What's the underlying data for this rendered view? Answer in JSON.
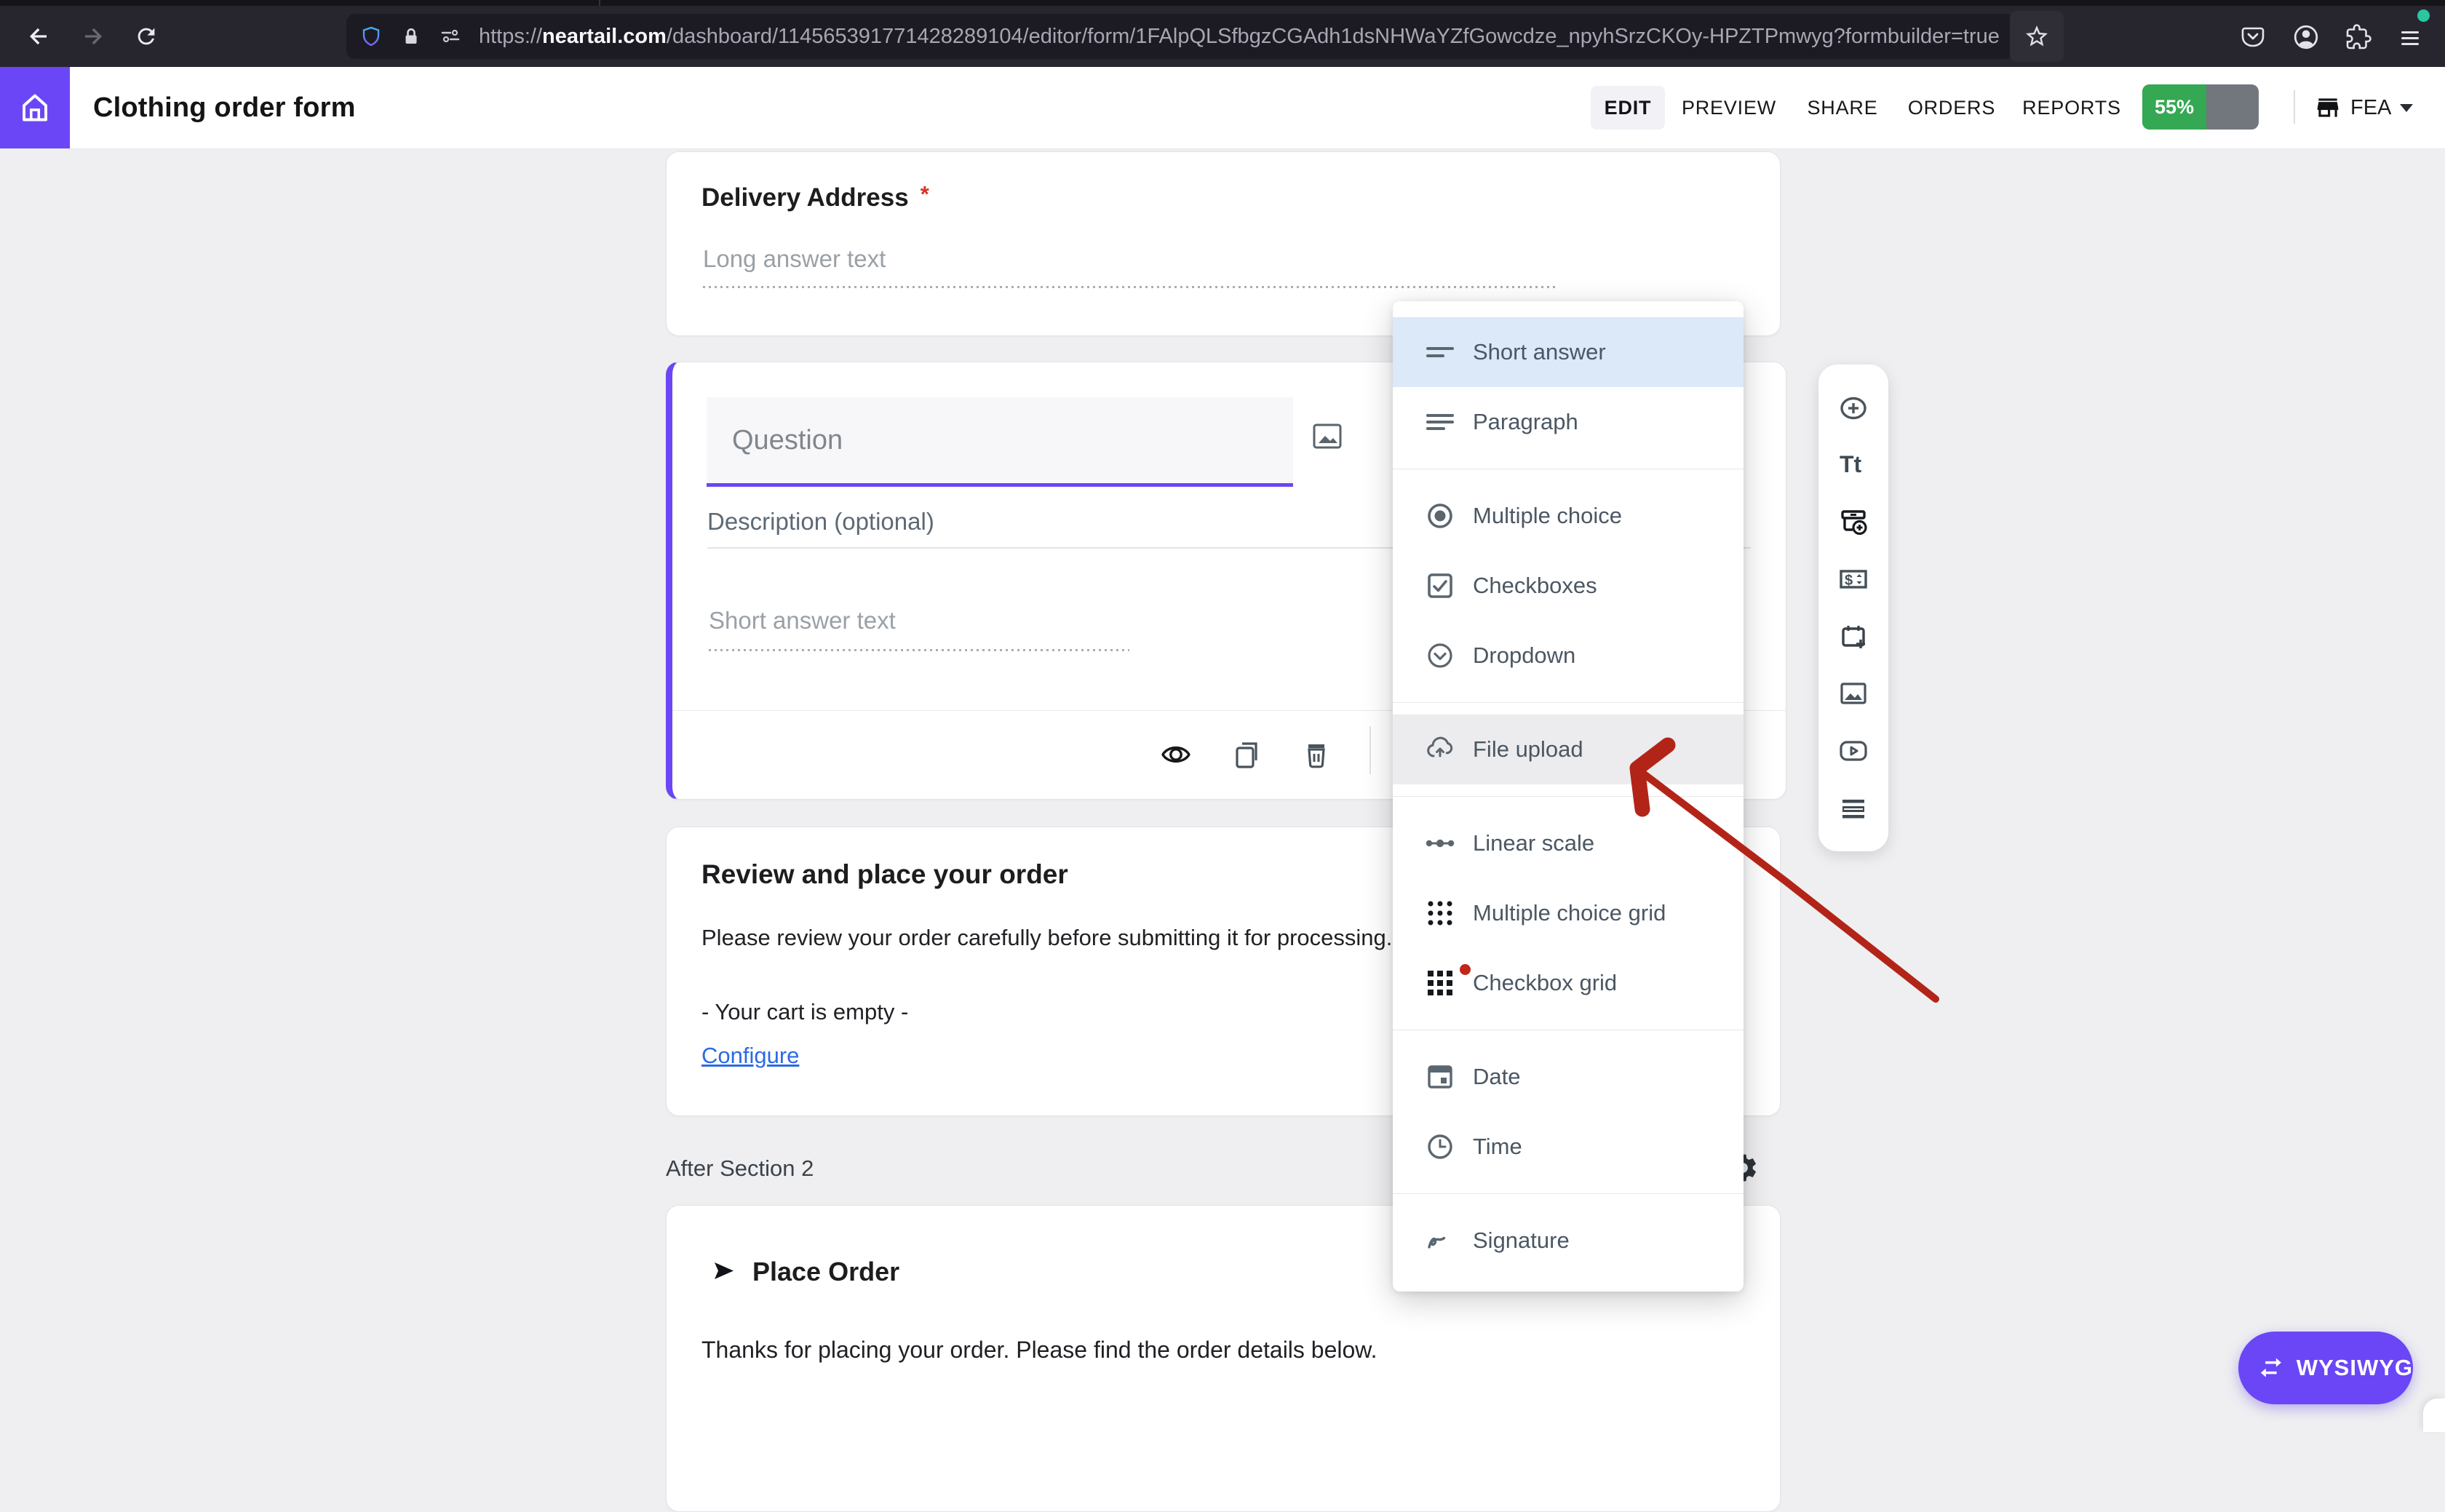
{
  "browser": {
    "url_scheme": "https://",
    "url_domain": "neartail.com",
    "url_path": "/dashboard/114565391771428289104/editor/form/1FAlpQLSfbgzCGAdh1dsNHWaYZfGowcdze_npyhSrzCKOy-HPZTPmwyg?formbuilder=true"
  },
  "header": {
    "title": "Clothing order form",
    "nav": [
      "EDIT",
      "PREVIEW",
      "SHARE",
      "ORDERS",
      "REPORTS"
    ],
    "progress_label": "55%",
    "progress_percent": 55,
    "account_label": "FEA"
  },
  "delivery_card": {
    "title": "Delivery Address",
    "required_mark": "*",
    "placeholder": "Long answer text"
  },
  "question_card": {
    "question_placeholder": "Question",
    "description_placeholder": "Description (optional)",
    "answer_placeholder": "Short answer text"
  },
  "type_menu": {
    "items": [
      {
        "label": "Short answer",
        "icon": "short-answer-icon",
        "state": "selected"
      },
      {
        "label": "Paragraph",
        "icon": "paragraph-icon"
      },
      {
        "label": "Multiple choice",
        "icon": "multiple-choice-icon"
      },
      {
        "label": "Checkboxes",
        "icon": "checkboxes-icon"
      },
      {
        "label": "Dropdown",
        "icon": "dropdown-icon"
      },
      {
        "label": "File upload",
        "icon": "file-upload-icon",
        "state": "hovered"
      },
      {
        "label": "Linear scale",
        "icon": "linear-scale-icon"
      },
      {
        "label": "Multiple choice grid",
        "icon": "multiple-choice-grid-icon"
      },
      {
        "label": "Checkbox grid",
        "icon": "checkbox-grid-icon",
        "badge": "red-dot"
      },
      {
        "label": "Date",
        "icon": "date-icon"
      },
      {
        "label": "Time",
        "icon": "time-icon"
      },
      {
        "label": "Signature",
        "icon": "signature-icon"
      }
    ]
  },
  "review_card": {
    "title": "Review and place your order",
    "body": "Please review your order carefully before submitting it for processing.",
    "cart_status": "- Your cart is empty -",
    "configure_label": "Configure"
  },
  "section_footer": {
    "label": "After Section 2"
  },
  "place_order_card": {
    "title": "Place Order",
    "body": "Thanks for placing your order. Please find the order details below."
  },
  "wysiwyg_button": {
    "label": "WYSIWYG"
  },
  "colors": {
    "accent_purple": "#6b46f6",
    "progress_green": "#34a853",
    "menu_selected_blue": "#dbe9f8",
    "menu_hover_gray": "#ececee",
    "annotation_red": "#b32418",
    "link_blue": "#2b6be4"
  }
}
